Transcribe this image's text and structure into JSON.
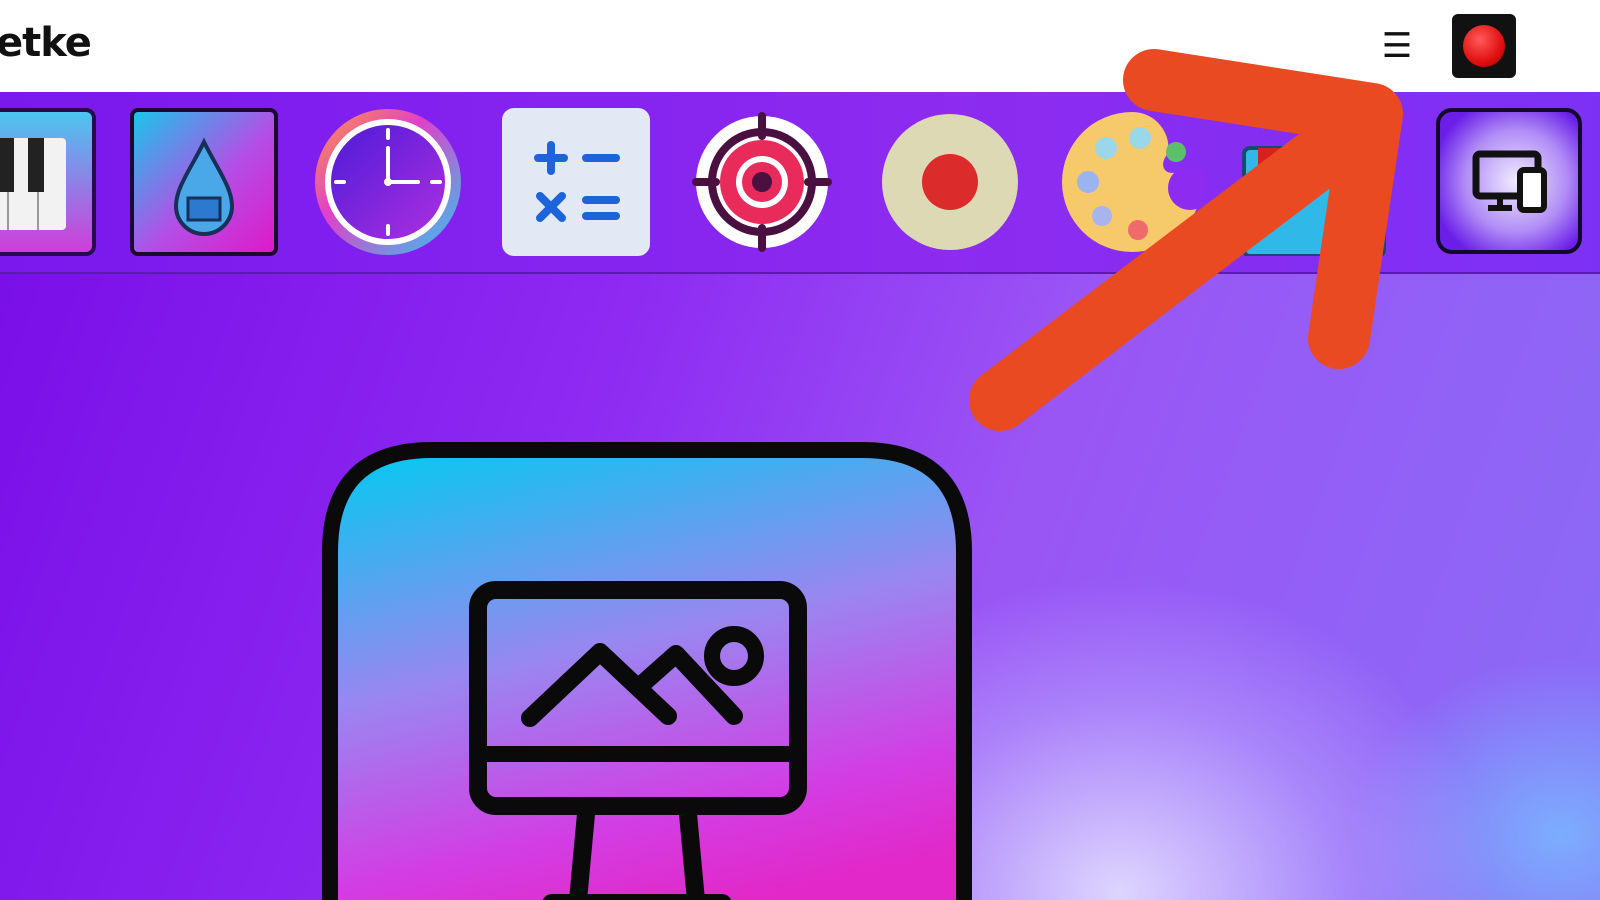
{
  "header": {
    "brand_text": "etke",
    "menu_icon": "hamburger-menu-icon",
    "menu_glyph": "☰",
    "record_icon": "record-icon",
    "record_color": "#e01010"
  },
  "dock": {
    "apps": [
      {
        "icon": "piano-icon"
      },
      {
        "icon": "water-drop-icon"
      },
      {
        "icon": "clock-icon"
      },
      {
        "icon": "calculator-icon"
      },
      {
        "icon": "target-icon"
      },
      {
        "icon": "record-circle-icon"
      },
      {
        "icon": "paint-palette-icon"
      },
      {
        "icon": "partial-app-icon"
      },
      {
        "icon": "devices-icon"
      }
    ]
  },
  "main": {
    "featured_app_icon": "desktop-image-icon"
  },
  "annotation": {
    "arrow_color": "#ea4a22"
  }
}
